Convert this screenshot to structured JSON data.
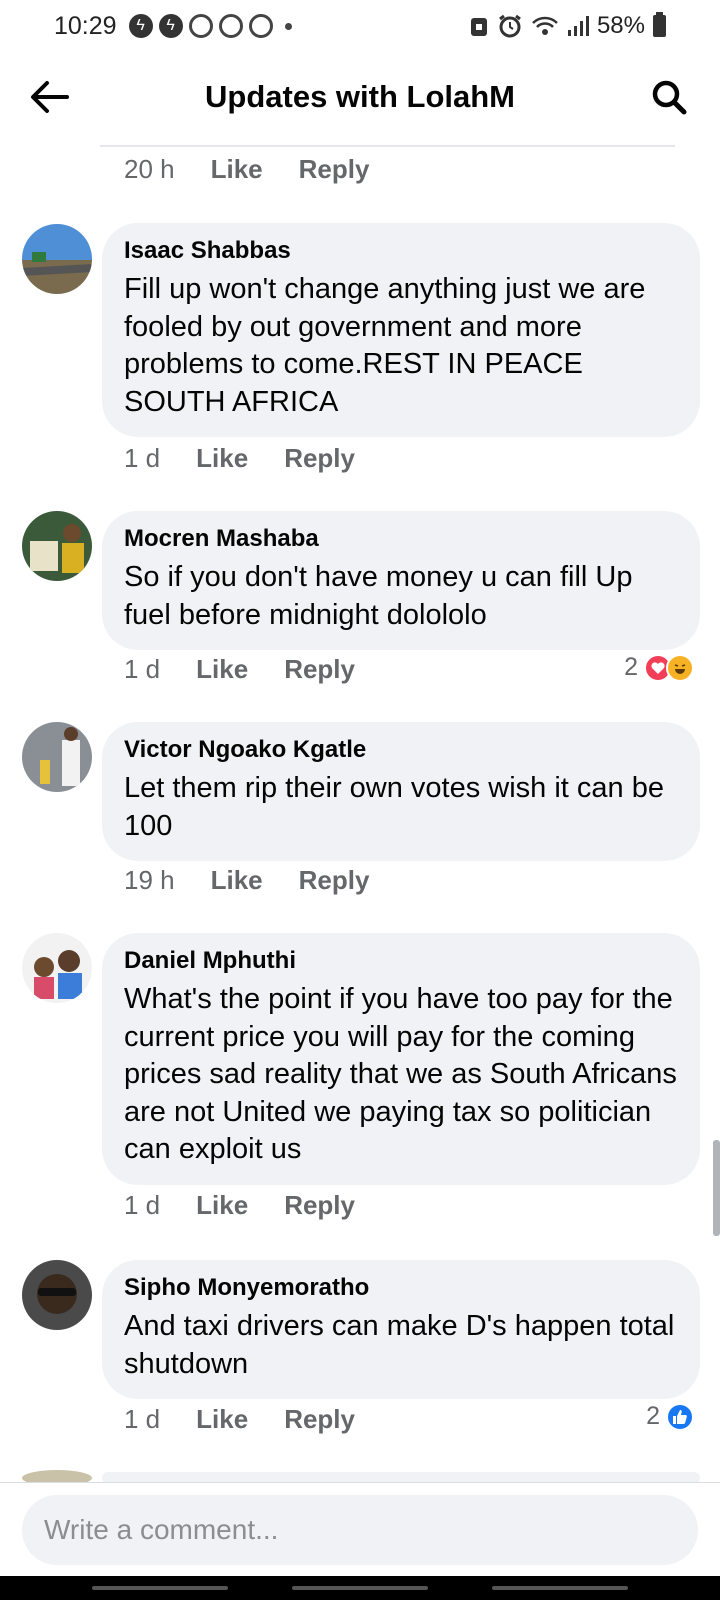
{
  "status_bar": {
    "time": "10:29",
    "battery": "58%",
    "icons": [
      "bolt-icon",
      "bolt-icon",
      "recycle-icon",
      "recycle-icon",
      "recycle-icon",
      "dot-icon",
      "sim-icon",
      "alarm-icon",
      "wifi-icon",
      "signal-icon",
      "battery-icon"
    ]
  },
  "header": {
    "title": "Updates with LolahM",
    "back_icon": "arrow-left-icon",
    "search_icon": "search-icon"
  },
  "previous_meta": {
    "time": "20 h",
    "like": "Like",
    "reply": "Reply"
  },
  "comments": [
    {
      "name": "Isaac Shabbas",
      "text": "Fill up won't change anything just we are fooled by out government and more problems to come.REST IN PEACE SOUTH AFRICA",
      "time": "1 d",
      "like": "Like",
      "reply": "Reply"
    },
    {
      "name": "Mocren Mashaba",
      "text": "So if you don't have money u  can fill Up fuel before midnight dolololo",
      "time": "1 d",
      "like": "Like",
      "reply": "Reply",
      "reaction_count": "2",
      "reaction_icons": [
        "love-icon",
        "haha-icon"
      ]
    },
    {
      "name": "Victor Ngoako Kgatle",
      "text": "Let them rip their own votes wish it can be 100",
      "time": "19 h",
      "like": "Like",
      "reply": "Reply"
    },
    {
      "name": "Daniel Mphuthi",
      "text": "What's the point if you have too pay for the current price you will pay for the coming prices sad reality that we as South Africans are not United we paying tax so politician can exploit us",
      "time": "1 d",
      "like": "Like",
      "reply": "Reply"
    },
    {
      "name": "Sipho Monyemoratho",
      "text": "And taxi drivers can make D's happen total shutdown",
      "time": "1 d",
      "like": "Like",
      "reply": "Reply",
      "reaction_count": "2",
      "reaction_icons": [
        "like-icon"
      ]
    }
  ],
  "composer": {
    "placeholder": "Write a comment..."
  },
  "colors": {
    "accent": "#1877f2",
    "bubble": "#f0f2f5",
    "meta": "#65676b",
    "love": "#f33e58",
    "haha": "#f7b125"
  }
}
